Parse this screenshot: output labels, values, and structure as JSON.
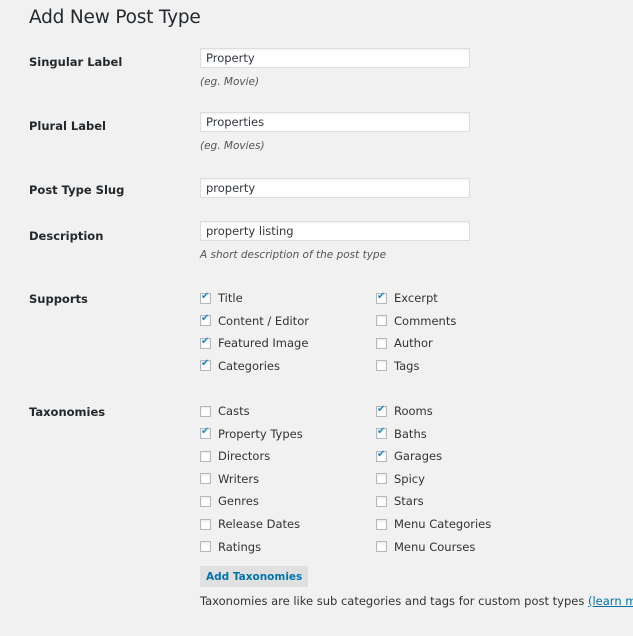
{
  "page_title": "Add New Post Type",
  "fields": {
    "singular": {
      "label": "Singular Label",
      "value": "Property",
      "hint": "(eg. Movie)"
    },
    "plural": {
      "label": "Plural Label",
      "value": "Properties",
      "hint": "(eg. Movies)"
    },
    "slug": {
      "label": "Post Type Slug",
      "value": "property"
    },
    "description": {
      "label": "Description",
      "value": "property listing",
      "hint": "A short description of the post type"
    }
  },
  "supports": {
    "label": "Supports",
    "items": [
      {
        "label": "Title",
        "checked": true
      },
      {
        "label": "Content / Editor",
        "checked": true
      },
      {
        "label": "Featured Image",
        "checked": true
      },
      {
        "label": "Categories",
        "checked": true
      },
      {
        "label": "Excerpt",
        "checked": true
      },
      {
        "label": "Comments",
        "checked": false
      },
      {
        "label": "Author",
        "checked": false
      },
      {
        "label": "Tags",
        "checked": false
      }
    ]
  },
  "taxonomies": {
    "label": "Taxonomies",
    "items": [
      {
        "label": "Casts",
        "checked": false
      },
      {
        "label": "Property Types",
        "checked": true
      },
      {
        "label": "Directors",
        "checked": false
      },
      {
        "label": "Writers",
        "checked": false
      },
      {
        "label": "Genres",
        "checked": false
      },
      {
        "label": "Release Dates",
        "checked": false
      },
      {
        "label": "Ratings",
        "checked": false
      },
      {
        "label": "Rooms",
        "checked": true
      },
      {
        "label": "Baths",
        "checked": true
      },
      {
        "label": "Garages",
        "checked": true
      },
      {
        "label": "Spicy",
        "checked": false
      },
      {
        "label": "Stars",
        "checked": false
      },
      {
        "label": "Menu Categories",
        "checked": false
      },
      {
        "label": "Menu Courses",
        "checked": false
      }
    ],
    "add_button": "Add Taxonomies",
    "footer_text": "Taxonomies are like sub categories and tags for custom post types ",
    "learn_more": "(learn more)."
  }
}
